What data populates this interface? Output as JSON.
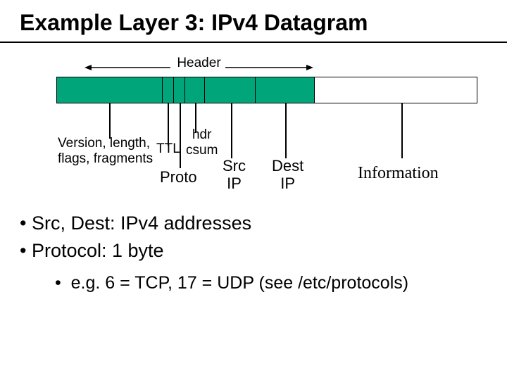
{
  "title": "Example Layer 3: IPv4 Datagram",
  "headerLabel": "Header",
  "fields": {
    "vlff": "Version, length,\nflags, fragments",
    "ttl": "TTL",
    "hdrcsum": "hdr\ncsum",
    "proto": "Proto",
    "srcip": "Src\nIP",
    "destip": "Dest\nIP",
    "info": "Information"
  },
  "bullets": {
    "b1": "Src, Dest: IPv4 addresses",
    "b2": "Protocol: 1 byte",
    "b2a": "e.g. 6 = TCP, 17 = UDP (see /etc/protocols)"
  },
  "chart_data": {
    "type": "table",
    "title": "IPv4 Datagram header layout (proportional widths, not to byte scale)",
    "segments": [
      {
        "name": "Version, length, flags, fragments",
        "color": "#00A67A",
        "width_units": 5
      },
      {
        "name": "TTL",
        "color": "#00A67A",
        "width_units": 0.5
      },
      {
        "name": "Proto",
        "color": "#00A67A",
        "width_units": 0.5
      },
      {
        "name": "hdr csum",
        "color": "#00A67A",
        "width_units": 1
      },
      {
        "name": "Src IP",
        "color": "#00A67A",
        "width_units": 2.5
      },
      {
        "name": "Dest IP",
        "color": "#00A67A",
        "width_units": 2.8
      },
      {
        "name": "Information (payload)",
        "color": "#FFFFFF",
        "width_units": 7
      }
    ],
    "header_span_segments": [
      "Version, length, flags, fragments",
      "TTL",
      "Proto",
      "hdr csum",
      "Src IP",
      "Dest IP"
    ]
  }
}
